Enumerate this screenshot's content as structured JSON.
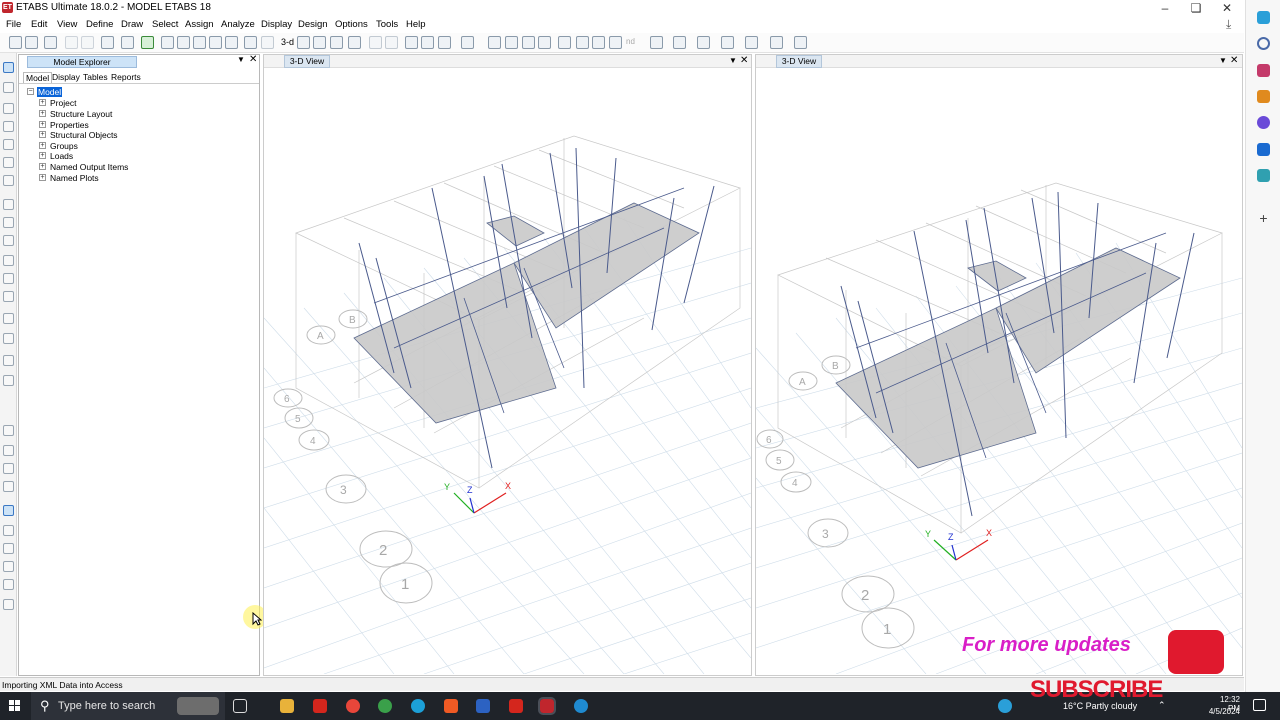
{
  "window": {
    "title": "ETABS Ultimate 18.0.2 - MODEL ETABS 18",
    "app_icon": "ET",
    "buttons": [
      "minimize",
      "restore",
      "close"
    ]
  },
  "menu": [
    "File",
    "Edit",
    "View",
    "Define",
    "Draw",
    "Select",
    "Assign",
    "Analyze",
    "Display",
    "Design",
    "Options",
    "Tools",
    "Help"
  ],
  "toolbar": {
    "text_3d": "3-d",
    "text_nd": "nd"
  },
  "explorer": {
    "title": "Model Explorer",
    "tabs": [
      "Model",
      "Display",
      "Tables",
      "Reports"
    ],
    "root": "Model",
    "items": [
      "Project",
      "Structure Layout",
      "Properties",
      "Structural Objects",
      "Groups",
      "Loads",
      "Named Output Items",
      "Named Plots"
    ]
  },
  "views": [
    {
      "tab": "3-D View"
    },
    {
      "tab": "3-D View"
    }
  ],
  "model_labels": {
    "grids_left": [
      "A",
      "B",
      "6",
      "5",
      "4",
      "3",
      "2",
      "1"
    ],
    "axes": {
      "x": "X",
      "y": "Y",
      "z": "Z"
    }
  },
  "status": {
    "text": "Importing XML Data into Access"
  },
  "taskbar": {
    "search_placeholder": "Type here to search",
    "weather": "16°C  Partly cloudy",
    "time": "12:32 PM",
    "date": "4/5/2024"
  },
  "overlay": {
    "promo": "For more updates",
    "subscribe": "SUBSCRIBE"
  },
  "colors": {
    "slab": "#c9c9c9",
    "column": "#4a5a8c",
    "grid": "#bcd0e0",
    "promo": "#d91ec7",
    "subscribe": "#e0192e",
    "taskbar": "#1f2329"
  }
}
